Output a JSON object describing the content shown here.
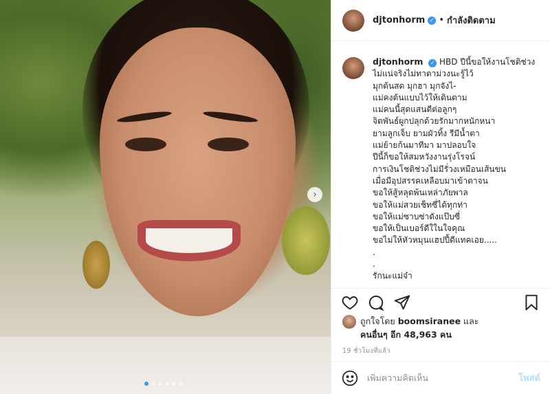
{
  "post": {
    "author": "djtonhorm",
    "separator": "•",
    "follow_status": "กำลังติดตาม",
    "caption_lines": [
      "HBD ปีนี้ขอให้งานโชติช่วง",
      "ไม่แน่จริงไม่ทาตาม่วงนะรู้ไว้",
      "มุกต้นสด มุกฮา มุกจังไ-",
      "แม่คงต้นแบบไว้ให้เดินตาม",
      "แม่คนนี้สุดแสนดีต่อลูกๆ",
      "จิตพันธ์ผูกปลุกด้วยรักมากหนักหนา",
      "ยามลูกเจ็บ ยามผัวทิ้ง รีมีน้ำตา",
      "แม่ย้ายก้นมาทีมา มาปลอบใจ",
      "ปีนี้ก็ขอให้สมหวังงานรุ่งโรจน์",
      "การเงินโชติช่วงไม่มีรั่วงเหมือนเส้นขน",
      "เมื่อมีอุปสรรคเหลือบมาเข้าตาจน",
      "ขอให้สู้หลุดพ้นเหล่าภัยพาล",
      "ขอให้แม่สวยเช็ทซี่ได้ทุกท่า",
      "ขอให้แม่ซาบซ่าดังแป๊บซี่",
      "ขอให้เป็นเบอร์ดีใในใจคุณ",
      "ขอไม่ให้หัวหมุนแฮปปี้ดีแทคเอย.....",
      ".",
      ".",
      "รักนะแม่จ๋า"
    ],
    "likes_prefix": "ถูกใจโดย",
    "liked_by": "boomsiranee",
    "likes_and": "และ",
    "likes_others_label": "คนอื่นๆ อีก 48,963 คน",
    "time_ago": "19 ชั่วโมงที่แล้ว",
    "carousel_total": 6,
    "carousel_current": 1
  },
  "comment": {
    "placeholder": "เพิ่มความคิดเห็น",
    "post_label": "โพสต์"
  },
  "icons": {
    "like": "heart-icon",
    "comment": "comment-icon",
    "share": "share-icon",
    "save": "bookmark-icon",
    "emoji": "emoji-icon",
    "next": "chevron-right-icon",
    "verified": "verified-badge-icon"
  },
  "colors": {
    "verified": "#3897f0",
    "post_disabled": "#b2dffc",
    "muted": "#8e8e8e",
    "text": "#262626"
  }
}
